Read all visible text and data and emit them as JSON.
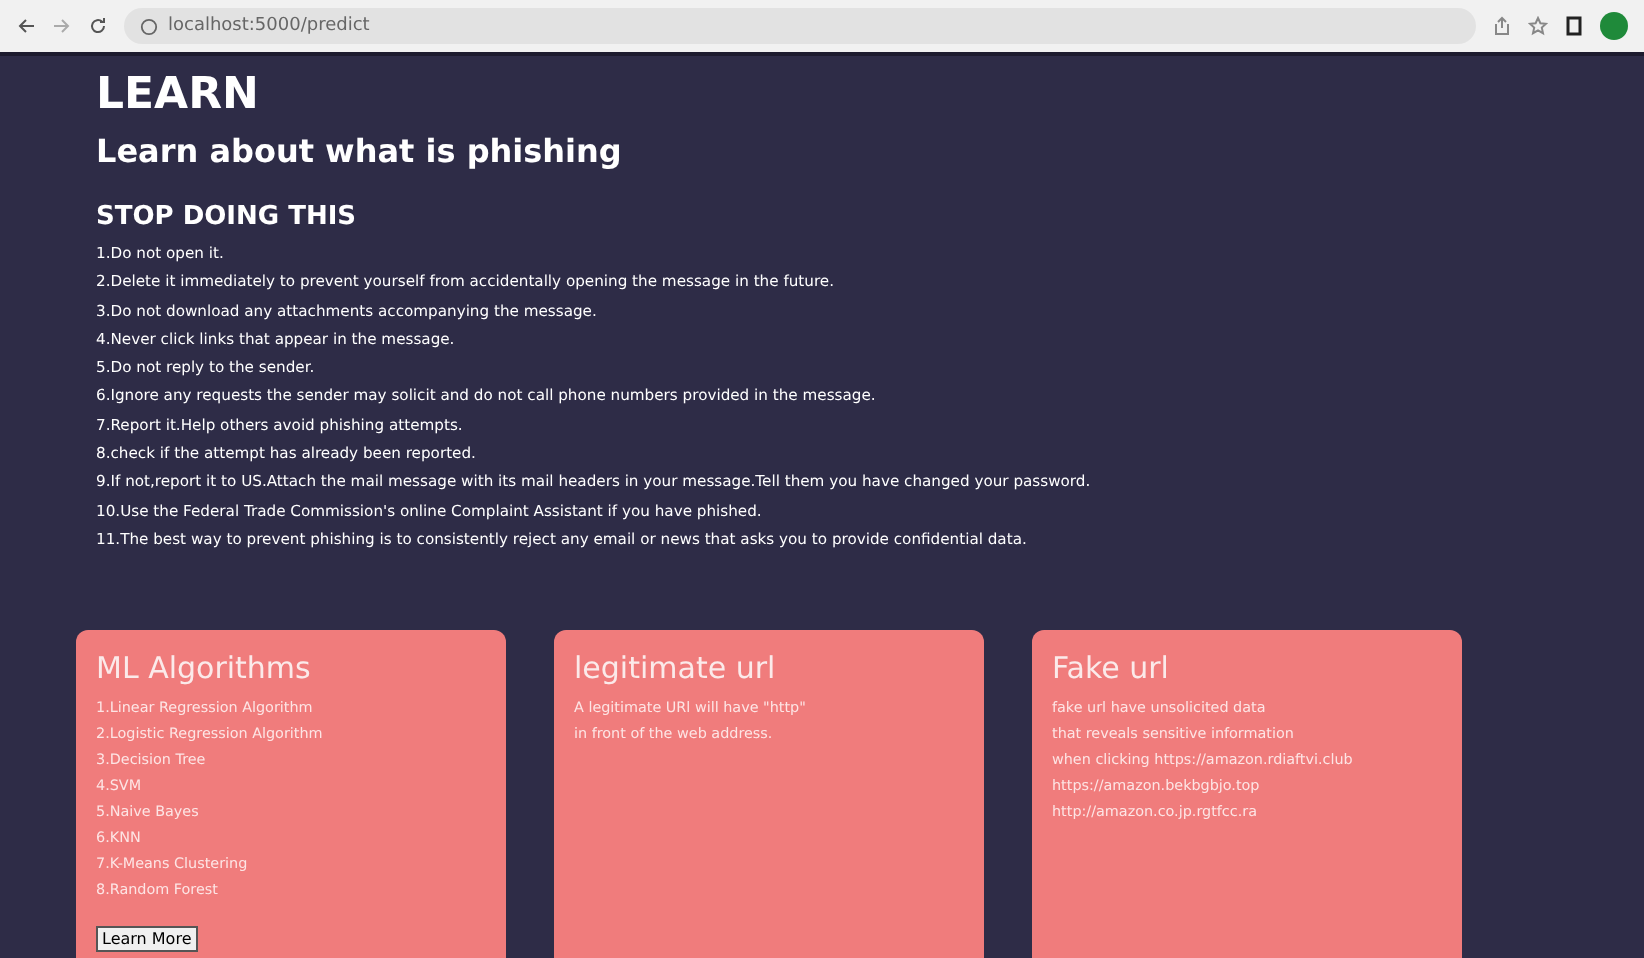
{
  "browser": {
    "url": "localhost:5000/predict"
  },
  "title": "LEARN",
  "subtitle": "Learn about what is phishing",
  "section_heading": "STOP DOING THIS",
  "steps": [
    "1.Do not open it.",
    "2.Delete it immediately to prevent yourself from accidentally opening the message in the future.",
    "3.Do not download any attachments accompanying the message.",
    "4.Never click links that appear in the message.",
    "5.Do not reply to the sender.",
    "6.Ignore any requests the sender may solicit and do not call phone numbers provided in the message.",
    "7.Report it.Help others avoid phishing attempts.",
    "8.check if the attempt has already been reported.",
    "9.If not,report it to US.Attach the mail message with its mail headers in your message.Tell them you have changed your password.",
    "10.Use the Federal Trade Commission's online Complaint Assistant if you have phished.",
    "11.The best way to prevent phishing is to consistently reject any email or news that asks you to provide confidential data."
  ],
  "cards": [
    {
      "title": "ML Algorithms",
      "lines": [
        "1.Linear Regression Algorithm",
        "2.Logistic Regression Algorithm",
        "3.Decision Tree",
        "4.SVM",
        "5.Naive Bayes",
        "6.KNN",
        "7.K-Means Clustering",
        "8.Random Forest"
      ],
      "button": "Learn More"
    },
    {
      "title": "legitimate url",
      "lines": [
        "A legitimate URl will have \"http\"",
        "in front of the web address."
      ]
    },
    {
      "title": "Fake url",
      "lines": [
        "fake url have unsolicited data",
        "that reveals sensitive information",
        "when clicking https://amazon.rdiaftvi.club",
        "https://amazon.bekbgbjo.top",
        "http://amazon.co.jp.rgtfcc.ra"
      ]
    }
  ]
}
